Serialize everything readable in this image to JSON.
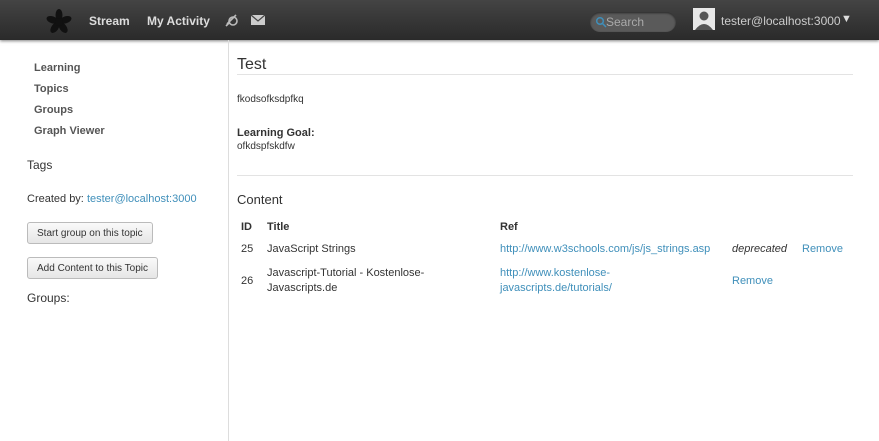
{
  "topbar": {
    "logo_icon": "asterisk-logo-icon",
    "nav": {
      "stream": "Stream",
      "my_activity": "My Activity"
    },
    "icons": [
      "notification-icon",
      "mail-icon"
    ],
    "search": {
      "placeholder": "Search",
      "value": ""
    },
    "user": {
      "email": "tester@localhost:3000",
      "caret": "▼"
    }
  },
  "sidebar": {
    "nav": [
      "Learning",
      "Topics",
      "Groups",
      "Graph Viewer"
    ],
    "tags_label": "Tags",
    "created_by_label": "Created by:",
    "created_by_user": "tester@localhost:3000",
    "start_group_button": "Start group on this topic",
    "add_content_button": "Add Content to this Topic",
    "groups_label": "Groups:"
  },
  "topic": {
    "title": "Test",
    "description": "fkodsofksdpfkq",
    "learning_goal_label": "Learning Goal:",
    "learning_goal": "ofkdspfskdfw",
    "content_heading": "Content"
  },
  "content_table": {
    "headers": {
      "id": "ID",
      "title": "Title",
      "ref": "Ref"
    },
    "rows": [
      {
        "id": "25",
        "title": "JavaScript Strings",
        "ref": "http://www.w3schools.com/js/js_strings.asp",
        "status": "deprecated",
        "action": "Remove"
      },
      {
        "id": "26",
        "title_line1": "Javascript-Tutorial - Kostenlose-",
        "title_line2": "Javascripts.de",
        "ref_line1": "http://www.kostenlose-",
        "ref_line2": "javascripts.de/tutorials/",
        "status": "",
        "action": "Remove"
      }
    ]
  },
  "colors": {
    "link": "#3f8fba",
    "topbar": "#333333"
  }
}
